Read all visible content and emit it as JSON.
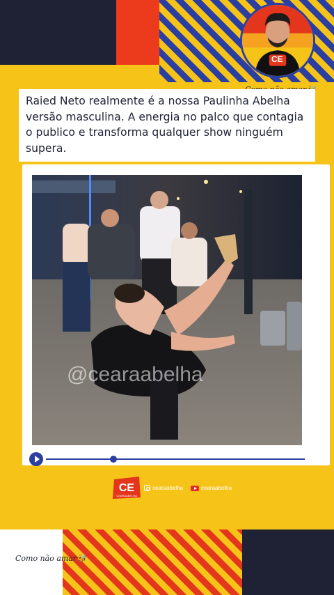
{
  "caption": {
    "text": "Raied Neto realmente é a nossa Paulinha Abelha versão masculina. A energia no palco que contagia o publico e transforma qualquer show ninguém supera."
  },
  "brand": {
    "tagline_top": "Como não amar🐝",
    "tagline_bottom": "Como não amar🐝",
    "logo_text": "CE",
    "logo_subtext": "CEARAABELHA"
  },
  "video": {
    "watermark": "@cearaabelha",
    "progress": 0.26,
    "play_icon": "play-icon"
  },
  "social": {
    "instagram_handle": "cearaabelha",
    "youtube_handle": "cearaabelha",
    "instagram_icon": "instagram-icon",
    "youtube_icon": "youtube-icon"
  },
  "colors": {
    "yellow": "#f6c318",
    "navy": "#1f2235",
    "red": "#ec3a1d",
    "blue": "#2b3fa3"
  }
}
